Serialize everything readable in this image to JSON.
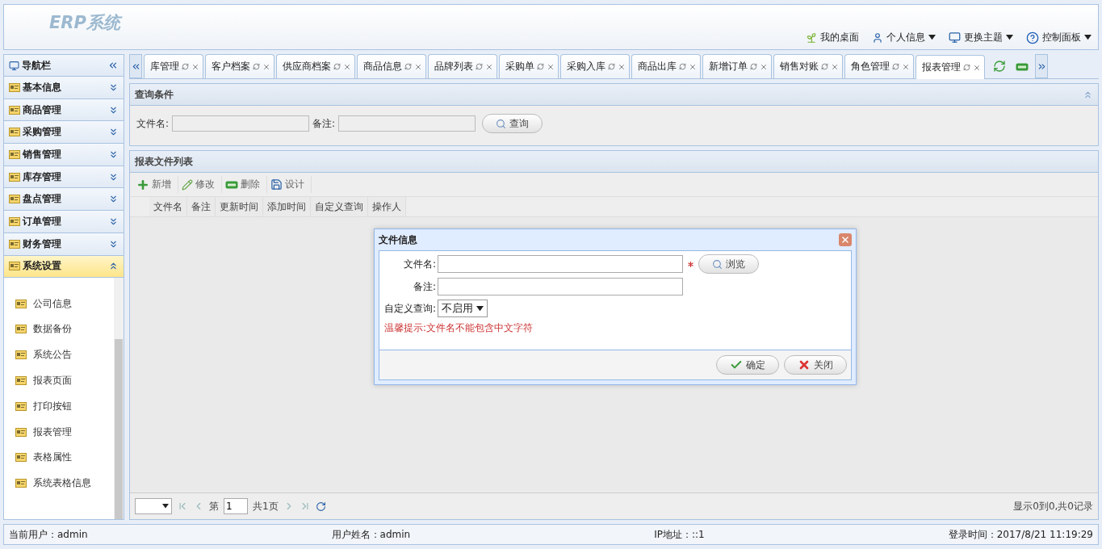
{
  "header": {
    "logo": "ERP系统",
    "links": [
      {
        "kind": "desktop",
        "label": "我的桌面",
        "dropdown": false
      },
      {
        "kind": "user",
        "label": "个人信息",
        "dropdown": true
      },
      {
        "kind": "theme",
        "label": "更换主题",
        "dropdown": true
      },
      {
        "kind": "help",
        "label": "控制面板",
        "dropdown": true
      }
    ]
  },
  "nav": {
    "title": "导航栏",
    "groups": [
      {
        "label": "基本信息",
        "selected": false
      },
      {
        "label": "商品管理",
        "selected": false
      },
      {
        "label": "采购管理",
        "selected": false
      },
      {
        "label": "销售管理",
        "selected": false
      },
      {
        "label": "库存管理",
        "selected": false
      },
      {
        "label": "盘点管理",
        "selected": false
      },
      {
        "label": "订单管理",
        "selected": false
      },
      {
        "label": "财务管理",
        "selected": false
      },
      {
        "label": "系统设置",
        "selected": true
      }
    ],
    "items": [
      "公司信息",
      "数据备份",
      "系统公告",
      "报表页面",
      "打印按钮",
      "报表管理",
      "表格属性",
      "系统表格信息"
    ]
  },
  "tabs": [
    {
      "label": "库管理",
      "selected": false
    },
    {
      "label": "客户档案",
      "selected": false
    },
    {
      "label": "供应商档案",
      "selected": false
    },
    {
      "label": "商品信息",
      "selected": false
    },
    {
      "label": "品牌列表",
      "selected": false
    },
    {
      "label": "采购单",
      "selected": false
    },
    {
      "label": "采购入库",
      "selected": false
    },
    {
      "label": "商品出库",
      "selected": false
    },
    {
      "label": "新增订单",
      "selected": false
    },
    {
      "label": "销售对账",
      "selected": false
    },
    {
      "label": "角色管理",
      "selected": false
    },
    {
      "label": "报表管理",
      "selected": true
    }
  ],
  "query": {
    "title": "查询条件",
    "fields": [
      {
        "label": "文件名:"
      },
      {
        "label": "备注:"
      }
    ],
    "button": "查询"
  },
  "list": {
    "title": "报表文件列表",
    "toolbar": [
      {
        "kind": "add",
        "label": "新增"
      },
      {
        "kind": "edit",
        "label": "修改"
      },
      {
        "kind": "delete",
        "label": "删除"
      },
      {
        "kind": "save",
        "label": "设计"
      }
    ],
    "columns": [
      "文件名",
      "备注",
      "更新时间",
      "添加时间",
      "自定义查询",
      "操作人"
    ],
    "pager": {
      "prefix": "第",
      "page": "1",
      "total": "共1页",
      "summary": "显示0到0,共0记录"
    }
  },
  "dialog": {
    "title": "文件信息",
    "fields": [
      {
        "kind": "text",
        "label": "文件名:",
        "required": true,
        "button": "浏览"
      },
      {
        "kind": "text",
        "label": "备注:",
        "required": false
      },
      {
        "kind": "select",
        "label": "自定义查询:",
        "value": "不启用"
      }
    ],
    "hint": "温馨提示:文件名不能包含中文字符",
    "buttons": [
      {
        "kind": "ok",
        "label": "确定"
      },
      {
        "kind": "cancel",
        "label": "关闭"
      }
    ]
  },
  "status": [
    "当前用户：admin",
    "用户姓名：admin",
    "IP地址：::1",
    "登录时间：2017/8/21 11:19:29"
  ]
}
